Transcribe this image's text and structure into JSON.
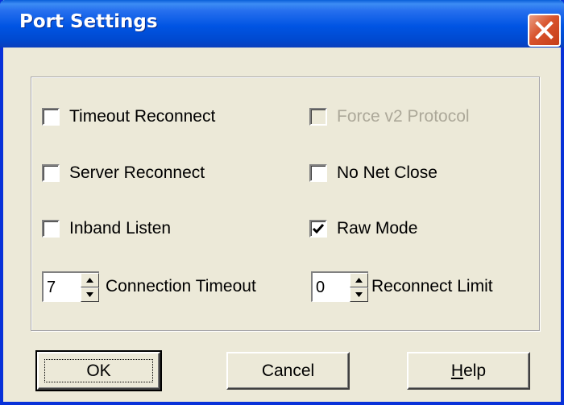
{
  "window": {
    "title": "Port Settings"
  },
  "checkboxes": {
    "timeout_reconnect": {
      "label": "Timeout Reconnect",
      "checked": false,
      "enabled": true
    },
    "force_v2_protocol": {
      "label": "Force v2 Protocol",
      "checked": false,
      "enabled": false
    },
    "server_reconnect": {
      "label": "Server Reconnect",
      "checked": false,
      "enabled": true
    },
    "no_net_close": {
      "label": "No Net Close",
      "checked": false,
      "enabled": true
    },
    "inband_listen": {
      "label": "Inband Listen",
      "checked": false,
      "enabled": true
    },
    "raw_mode": {
      "label": "Raw Mode",
      "checked": true,
      "enabled": true
    }
  },
  "spinners": {
    "connection_timeout": {
      "value": "7",
      "label": "Connection Timeout"
    },
    "reconnect_limit": {
      "value": "0",
      "label": "Reconnect Limit"
    }
  },
  "buttons": {
    "ok": "OK",
    "cancel": "Cancel",
    "help": "Help"
  },
  "icons": {
    "close": "close-icon",
    "checkmark": "checkmark-icon",
    "spin_up": "arrow-up-icon",
    "spin_down": "arrow-down-icon"
  },
  "colors": {
    "titlebar": "#0054E3",
    "face": "#ECE9D8",
    "close": "#D8532C",
    "disabled_text": "#ACA899"
  }
}
